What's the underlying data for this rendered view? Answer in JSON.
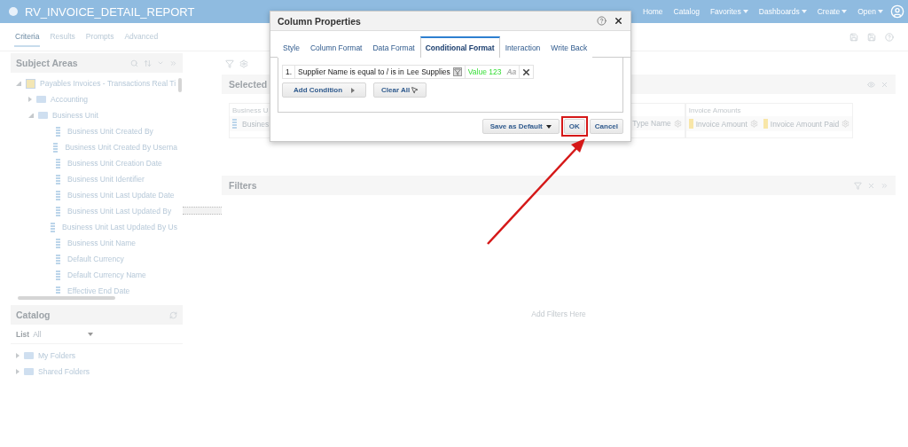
{
  "header": {
    "title": "RV_INVOICE_DETAIL_REPORT",
    "nav": [
      {
        "label": "Home",
        "menu": false
      },
      {
        "label": "Catalog",
        "menu": false
      },
      {
        "label": "Favorites",
        "menu": true
      },
      {
        "label": "Dashboards",
        "menu": true
      },
      {
        "label": "Create",
        "menu": true
      },
      {
        "label": "Open",
        "menu": true
      }
    ]
  },
  "tabs": [
    {
      "label": "Criteria",
      "selected": true
    },
    {
      "label": "Results",
      "selected": false
    },
    {
      "label": "Prompts",
      "selected": false
    },
    {
      "label": "Advanced",
      "selected": false
    }
  ],
  "subject_areas": {
    "title": "Subject Areas",
    "tree": [
      {
        "kind": "subject_area",
        "label": "Payables Invoices - Transactions Real Ti",
        "expanded": true,
        "children": [
          {
            "kind": "folder",
            "label": "Accounting",
            "expanded": false
          },
          {
            "kind": "folder",
            "label": "Business Unit",
            "expanded": true,
            "children": [
              {
                "kind": "column",
                "label": "Business Unit Created By"
              },
              {
                "kind": "column",
                "label": "Business Unit Created By Userna"
              },
              {
                "kind": "column",
                "label": "Business Unit Creation Date"
              },
              {
                "kind": "column",
                "label": "Business Unit Identifier"
              },
              {
                "kind": "column",
                "label": "Business Unit Last Update Date"
              },
              {
                "kind": "column",
                "label": "Business Unit Last Updated By"
              },
              {
                "kind": "column",
                "label": "Business Unit Last Updated By Us"
              },
              {
                "kind": "column",
                "label": "Business Unit Name"
              },
              {
                "kind": "column",
                "label": "Default Currency"
              },
              {
                "kind": "column",
                "label": "Default Currency Name"
              },
              {
                "kind": "column",
                "label": "Effective End Date"
              }
            ]
          }
        ]
      }
    ]
  },
  "catalog": {
    "title": "Catalog",
    "list_label": "List",
    "list_value": "All",
    "folders": [
      {
        "label": "My Folders",
        "expanded": false
      },
      {
        "label": "Shared Folders",
        "expanded": false
      }
    ]
  },
  "selected_columns": {
    "title": "Selected",
    "groups": [
      {
        "title": "Business U",
        "columns": [
          {
            "label": "Busines",
            "kind": "attribute"
          }
        ]
      },
      {
        "columns": [
          {
            "label": "Type Name",
            "kind": "cut"
          }
        ]
      },
      {
        "title": "Invoice Amounts",
        "columns": [
          {
            "label": "Invoice Amount",
            "kind": "measure"
          },
          {
            "label": "Invoice Amount Paid",
            "kind": "measure"
          }
        ]
      }
    ]
  },
  "filters": {
    "title": "Filters",
    "empty_text": "Add Filters Here"
  },
  "dialog": {
    "title": "Column Properties",
    "tabs": [
      {
        "label": "Style",
        "selected": false
      },
      {
        "label": "Column Format",
        "selected": false
      },
      {
        "label": "Data Format",
        "selected": false
      },
      {
        "label": "Conditional Format",
        "selected": true
      },
      {
        "label": "Interaction",
        "selected": false
      },
      {
        "label": "Write Back",
        "selected": false
      }
    ],
    "conditions": [
      {
        "number": "1.",
        "text": "Supplier Name is equal to / is in",
        "value": "Lee Supplies",
        "sample": "Value 123",
        "font_sample": "Aa"
      }
    ],
    "add_condition": "Add Condition",
    "clear_all": "Clear All",
    "save_default": "Save as Default",
    "ok": "OK",
    "cancel": "Cancel"
  }
}
